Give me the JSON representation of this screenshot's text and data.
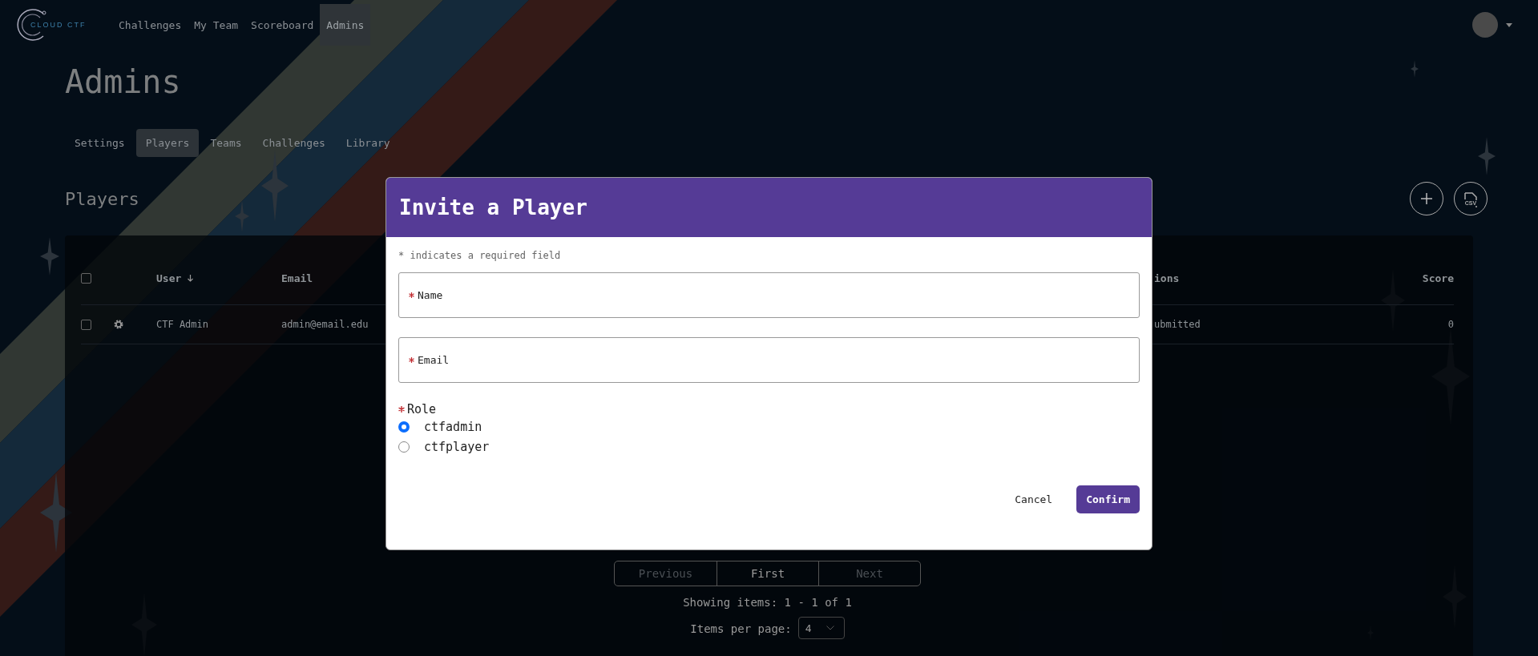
{
  "nav": {
    "logo": "CLOUD CTF",
    "links": [
      {
        "label": "Challenges",
        "selected": false
      },
      {
        "label": "My Team",
        "selected": false
      },
      {
        "label": "Scoreboard",
        "selected": false
      },
      {
        "label": "Admins",
        "selected": true
      }
    ]
  },
  "page_title": "Admins",
  "tabs": [
    {
      "label": "Settings",
      "selected": false
    },
    {
      "label": "Players",
      "selected": true
    },
    {
      "label": "Teams",
      "selected": false
    },
    {
      "label": "Challenges",
      "selected": false
    },
    {
      "label": "Library",
      "selected": false
    }
  ],
  "section_title": "Players",
  "csv_label": "CSV",
  "table": {
    "select_all": {
      "checked": false
    },
    "columns": [
      {
        "label": "User",
        "sorted": true
      },
      {
        "label": "Email",
        "sorted": false
      },
      {
        "label": "ions",
        "sorted": false
      },
      {
        "label": "Score",
        "sorted": false
      }
    ],
    "rows": [
      {
        "checked": false,
        "user": "CTF Admin",
        "email": "admin@email.edu",
        "status": "ubmitted",
        "score": "0"
      }
    ]
  },
  "pagination": {
    "buttons": [
      {
        "label": "Previous",
        "disabled": true
      },
      {
        "label": "First",
        "disabled": false
      },
      {
        "label": "Next",
        "disabled": true
      }
    ],
    "summary": "Showing items: 1 - 1 of 1",
    "per_page_label": "Items per page:",
    "per_page": "4"
  },
  "modal": {
    "title": "Invite a Player",
    "hint": "* indicates a required field",
    "fields": [
      {
        "label": "Name",
        "required": true
      },
      {
        "label": "Email",
        "required": true
      }
    ],
    "role": {
      "label": "Role",
      "required": true,
      "options": [
        {
          "label": "ctfadmin",
          "selected": true
        },
        {
          "label": "ctfplayer",
          "selected": false
        }
      ]
    },
    "buttons": [
      {
        "label": "Cancel",
        "kind": "text"
      },
      {
        "label": "Confirm",
        "kind": "primary"
      }
    ]
  }
}
